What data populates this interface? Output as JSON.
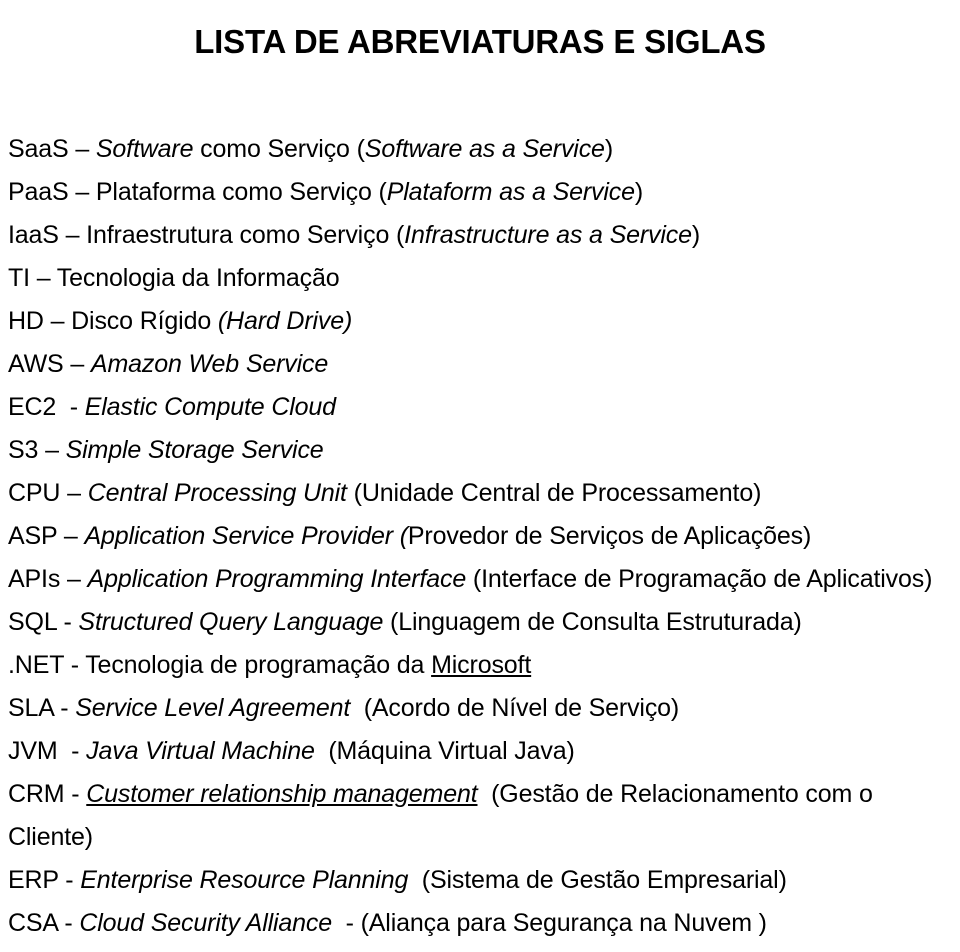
{
  "document": {
    "title": "LISTA DE ABREVIATURAS E SIGLAS",
    "language": "pt-BR",
    "background_color": "#ffffff",
    "text_color": "#000000"
  },
  "abbreviations": {
    "count": 18,
    "lines": [
      {
        "term": "SaaS",
        "segments": [
          {
            "text": "SaaS – ",
            "style": "regular"
          },
          {
            "text": "Software",
            "style": "italic"
          },
          {
            "text": " como Serviço (",
            "style": "regular"
          },
          {
            "text": "Software as a Service",
            "style": "italic"
          },
          {
            "text": ")",
            "style": "regular"
          }
        ]
      },
      {
        "term": "PaaS",
        "segments": [
          {
            "text": "PaaS – Plataforma como Serviço (",
            "style": "regular"
          },
          {
            "text": "Plataform as a Service",
            "style": "italic"
          },
          {
            "text": ")",
            "style": "regular"
          }
        ]
      },
      {
        "term": "IaaS",
        "segments": [
          {
            "text": "IaaS – Infraestrutura como Serviço (",
            "style": "regular"
          },
          {
            "text": "Infrastructure as a Service",
            "style": "italic"
          },
          {
            "text": ")",
            "style": "regular"
          }
        ]
      },
      {
        "term": "TI",
        "segments": [
          {
            "text": "TI – Tecnologia da Informação",
            "style": "regular"
          }
        ]
      },
      {
        "term": "HD",
        "segments": [
          {
            "text": "HD – Disco Rígido ",
            "style": "regular"
          },
          {
            "text": "(Hard Drive)",
            "style": "italic"
          }
        ]
      },
      {
        "term": "AWS",
        "segments": [
          {
            "text": "AWS – ",
            "style": "regular"
          },
          {
            "text": "Amazon Web Service",
            "style": "italic"
          }
        ]
      },
      {
        "term": "EC2",
        "segments": [
          {
            "text": "EC2  - ",
            "style": "regular"
          },
          {
            "text": "Elastic Compute Cloud",
            "style": "italic"
          }
        ]
      },
      {
        "term": "S3",
        "segments": [
          {
            "text": "S3 – ",
            "style": "regular"
          },
          {
            "text": "Simple Storage Service",
            "style": "italic"
          }
        ]
      },
      {
        "term": "CPU",
        "segments": [
          {
            "text": "CPU – ",
            "style": "regular"
          },
          {
            "text": "Central Processing Unit",
            "style": "italic"
          },
          {
            "text": " (Unidade Central de Processamento)",
            "style": "regular"
          }
        ]
      },
      {
        "term": "ASP",
        "segments": [
          {
            "text": "ASP – ",
            "style": "regular"
          },
          {
            "text": "Application Service Provider (",
            "style": "italic"
          },
          {
            "text": "Provedor de Serviços de Aplicações)",
            "style": "regular"
          }
        ]
      },
      {
        "term": "APIs",
        "segments": [
          {
            "text": "APIs – ",
            "style": "regular"
          },
          {
            "text": "Application Programming Interface",
            "style": "italic"
          },
          {
            "text": " (Interface de Programação de Aplicativos)",
            "style": "regular"
          }
        ]
      },
      {
        "term": "SQL",
        "segments": [
          {
            "text": "SQL - ",
            "style": "regular"
          },
          {
            "text": "Structured Query Language",
            "style": "italic"
          },
          {
            "text": " (Linguagem de Consulta Estruturada)",
            "style": "regular"
          }
        ]
      },
      {
        "term": ".NET",
        "segments": [
          {
            "text": ".NET - Tecnologia de programação da ",
            "style": "regular"
          },
          {
            "text": "Microsoft",
            "style": "underline"
          }
        ]
      },
      {
        "term": "SLA",
        "segments": [
          {
            "text": "SLA - ",
            "style": "regular"
          },
          {
            "text": "Service Level Agreement",
            "style": "italic"
          },
          {
            "text": "  (Acordo de Nível de Serviço)",
            "style": "regular"
          }
        ]
      },
      {
        "term": "JVM",
        "segments": [
          {
            "text": "JVM  - ",
            "style": "regular"
          },
          {
            "text": "Java Virtual Machine",
            "style": "italic"
          },
          {
            "text": "  (Máquina Virtual Java)",
            "style": "regular"
          }
        ]
      },
      {
        "term": "CRM",
        "segments": [
          {
            "text": "CRM - ",
            "style": "regular"
          },
          {
            "text": "Customer relationship management",
            "style": "italic-underline"
          },
          {
            "text": "  (Gestão de Relacionamento com o",
            "style": "regular"
          }
        ]
      },
      {
        "term": "CRM-continuation",
        "segments": [
          {
            "text": "Cliente)",
            "style": "regular"
          }
        ]
      },
      {
        "term": "ERP",
        "segments": [
          {
            "text": "ERP - ",
            "style": "regular"
          },
          {
            "text": "Enterprise Resource Planning",
            "style": "italic"
          },
          {
            "text": "  (Sistema de Gestão Empresarial)",
            "style": "regular"
          }
        ]
      },
      {
        "term": "CSA",
        "segments": [
          {
            "text": "CSA - ",
            "style": "regular"
          },
          {
            "text": "Cloud Security Alliance",
            "style": "italic"
          },
          {
            "text": "  - (Aliança para Segurança na Nuvem )",
            "style": "regular"
          }
        ]
      }
    ]
  }
}
